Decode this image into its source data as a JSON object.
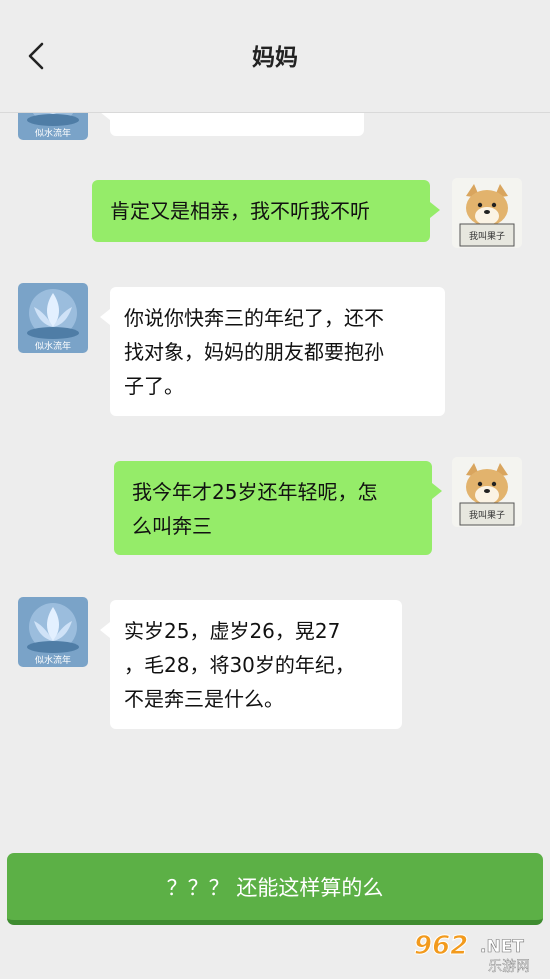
{
  "header": {
    "title": "妈妈"
  },
  "contacts": {
    "mom_avatar_caption": "似水流年",
    "me_avatar_caption": "我叫果子"
  },
  "messages": [
    {
      "side": "left",
      "text": ""
    },
    {
      "side": "right",
      "text": "肯定又是相亲，我不听我不听"
    },
    {
      "side": "left",
      "text": "你说你快奔三的年纪了，还不\n找对象，妈妈的朋友都要抱孙\n子了。"
    },
    {
      "side": "right",
      "text": "我今年才25岁还年轻呢，怎\n么叫奔三"
    },
    {
      "side": "left",
      "text": "实岁25，虚岁26，晃27\n，毛28，将30岁的年纪，\n不是奔三是什么。"
    }
  ],
  "reply": {
    "label": "？？？ 还能这样算的么"
  },
  "watermark": {
    "main": "962",
    "suffix": ".NET",
    "sub": "乐游网"
  },
  "colors": {
    "background": "#ededed",
    "bubble_self": "#95ec69",
    "bubble_other": "#ffffff",
    "reply_button": "#5cb046"
  }
}
